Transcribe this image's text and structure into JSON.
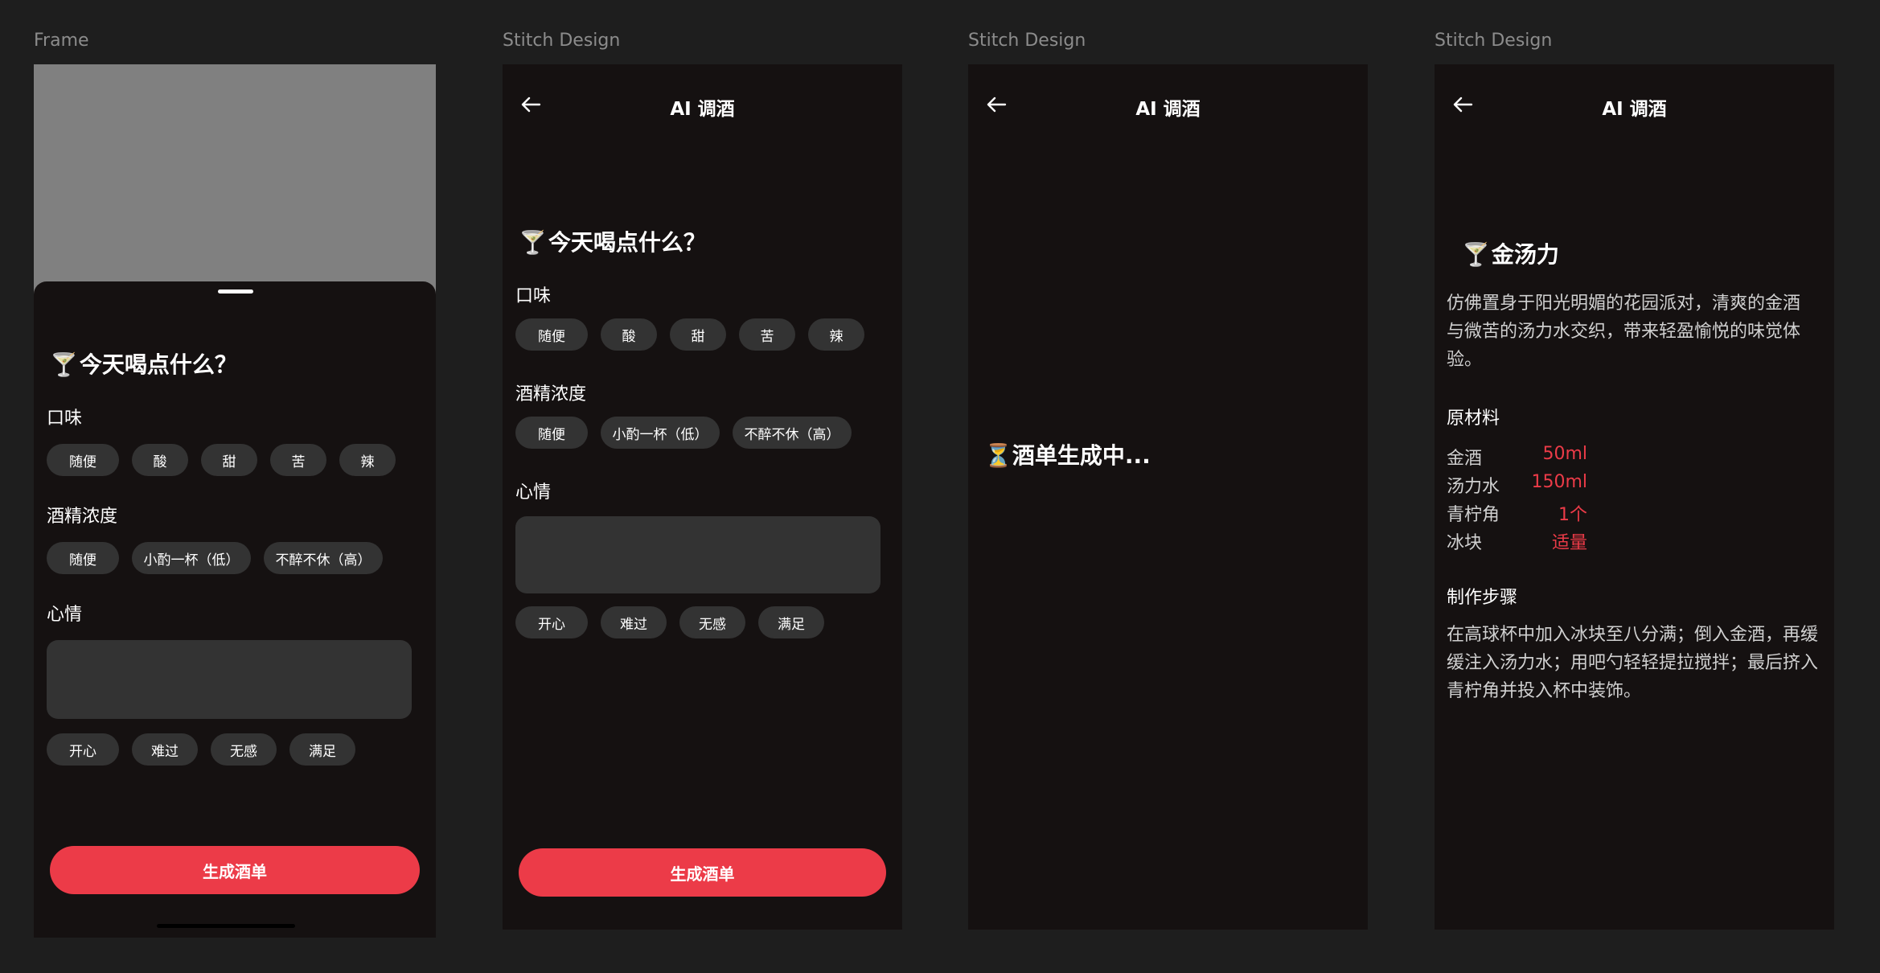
{
  "frames": {
    "frame1_label": "Frame",
    "frame2_label": "Stitch Design",
    "frame3_label": "Stitch Design",
    "frame4_label": "Stitch Design"
  },
  "app": {
    "title": "AI 调酒",
    "question_emoji": "🍸",
    "question": "今天喝点什么？",
    "taste_label": "口味",
    "taste_options": [
      "随便",
      "酸",
      "甜",
      "苦",
      "辣"
    ],
    "alcohol_label": "酒精浓度",
    "alcohol_options": [
      "随便",
      "小酌一杯（低）",
      "不醉不休（高）"
    ],
    "mood_label": "心情",
    "mood_options": [
      "开心",
      "难过",
      "无感",
      "满足"
    ],
    "generate_button": "生成酒单",
    "loading_emoji": "⏳",
    "loading_text": "酒单生成中..."
  },
  "result": {
    "emoji": "🍸",
    "name": "金汤力",
    "description": "仿佛置身于阳光明媚的花园派对，清爽的金酒与微苦的汤力水交织，带来轻盈愉悦的味觉体验。",
    "ingredients_label": "原材料",
    "ingredients": [
      {
        "name": "金酒",
        "amount": "50ml"
      },
      {
        "name": "汤力水",
        "amount": "150ml"
      },
      {
        "name": "青柠角",
        "amount": "1个"
      },
      {
        "name": "冰块",
        "amount": "适量"
      }
    ],
    "steps_label": "制作步骤",
    "steps": "在高球杯中加入冰块至八分满；倒入金酒，再缓缓注入汤力水；用吧勺轻轻提拉搅拌；最后挤入青柠角并投入杯中装饰。"
  },
  "colors": {
    "background": "#1e1e1e",
    "screen": "#151111",
    "chip": "#333333",
    "accent": "#ec3b48"
  },
  "icons": {
    "back": "arrow-left-icon"
  }
}
